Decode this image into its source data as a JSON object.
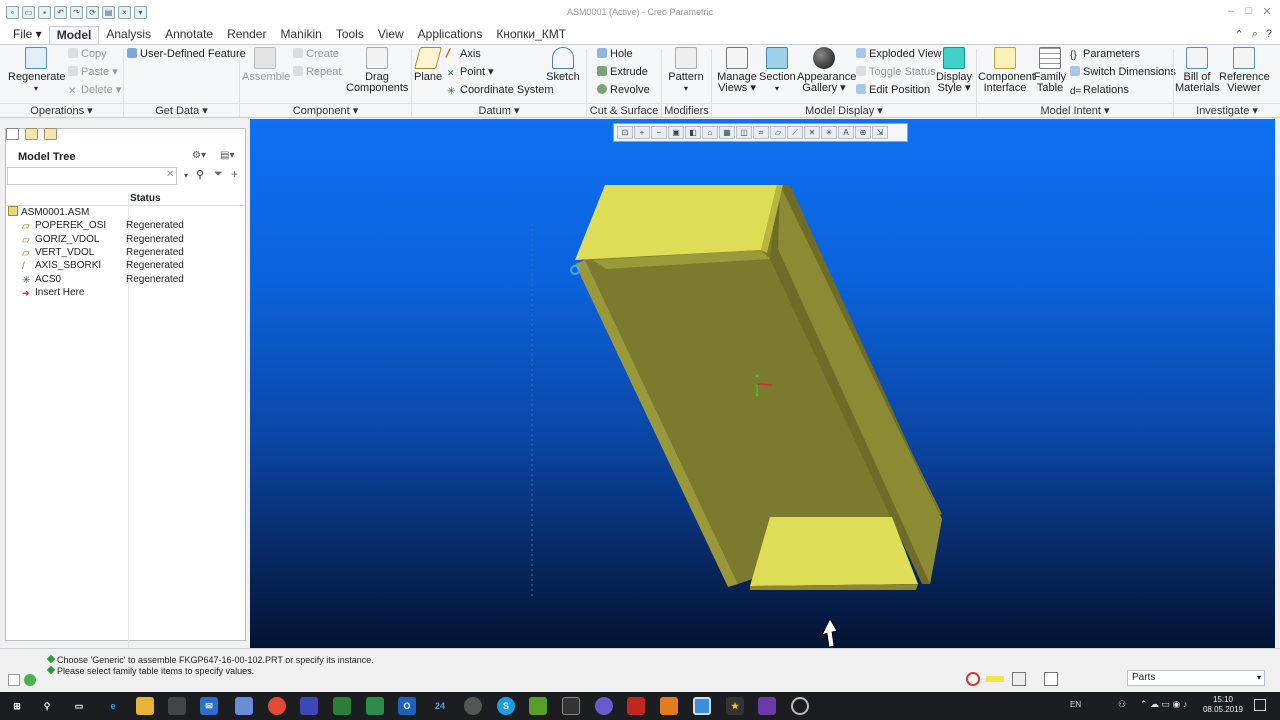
{
  "window": {
    "title": "ASM0001 (Active) - Creo Parametric"
  },
  "menu": {
    "tabs": [
      "File",
      "Model",
      "Analysis",
      "Annotate",
      "Render",
      "Manikin",
      "Tools",
      "View",
      "Applications",
      "Кнопки_КМТ"
    ],
    "active": "Model"
  },
  "ribbon": {
    "regenerate": "Regenerate",
    "copy": "Copy",
    "paste": "Paste",
    "delete": "Delete",
    "user_defined_feature": "User-Defined Feature",
    "assemble": "Assemble",
    "create": "Create",
    "repeat": "Repeat",
    "drag_components_1": "Drag",
    "drag_components_2": "Components",
    "plane": "Plane",
    "axis": "Axis",
    "point": "Point",
    "coordinate_system": "Coordinate System",
    "sketch": "Sketch",
    "hole": "Hole",
    "extrude": "Extrude",
    "revolve": "Revolve",
    "pattern": "Pattern",
    "manage_views_1": "Manage",
    "manage_views_2": "Views",
    "section": "Section",
    "appearance_gallery_1": "Appearance",
    "appearance_gallery_2": "Gallery",
    "exploded_view": "Exploded View",
    "toggle_status": "Toggle Status",
    "edit_position": "Edit Position",
    "display_style_1": "Display",
    "display_style_2": "Style",
    "component_interface_1": "Component",
    "component_interface_2": "Interface",
    "family_table_1": "Family",
    "family_table_2": "Table",
    "parameters": "Parameters",
    "switch_dimensions": "Switch Dimensions",
    "relations": "Relations",
    "bill_of_materials_1": "Bill of",
    "bill_of_materials_2": "Materials",
    "reference_viewer_1": "Reference",
    "reference_viewer_2": "Viewer",
    "groups": {
      "operations": "Operations",
      "get_data": "Get Data",
      "component": "Component",
      "datum": "Datum",
      "cut_surface": "Cut & Surface",
      "modifiers": "Modifiers",
      "model_display": "Model Display",
      "model_intent": "Model Intent",
      "investigate": "Investigate"
    }
  },
  "model_tree": {
    "title": "Model Tree",
    "search_value": "",
    "status_header": "Status",
    "items": [
      {
        "name": "ASM0001.ASM",
        "status": ""
      },
      {
        "name": "POPEREK_OSI",
        "status": "Regenerated"
      },
      {
        "name": "GORIZ_VDOL",
        "status": "Regenerated"
      },
      {
        "name": "VERT_VDOL",
        "status": "Regenerated"
      },
      {
        "name": "AXIS_SBORKI",
        "status": "Regenerated"
      },
      {
        "name": "ACS0",
        "status": "Regenerated"
      },
      {
        "name": "Insert Here",
        "status": ""
      }
    ]
  },
  "messages": [
    "Choose 'Generic' to assemble FKGP647-16-00-102.PRT or specify its instance.",
    "Please select family table items to specify values."
  ],
  "filter": {
    "value": "Parts"
  },
  "taskbar": {
    "lang": "EN",
    "time": "15:10",
    "date": "08.05.2019",
    "badge": "24"
  },
  "colors": {
    "part_yellow": "#d9d94a",
    "part_shadow": "#7a7a2a",
    "viewport_top": "#0e70f2",
    "viewport_bottom": "#041433"
  }
}
